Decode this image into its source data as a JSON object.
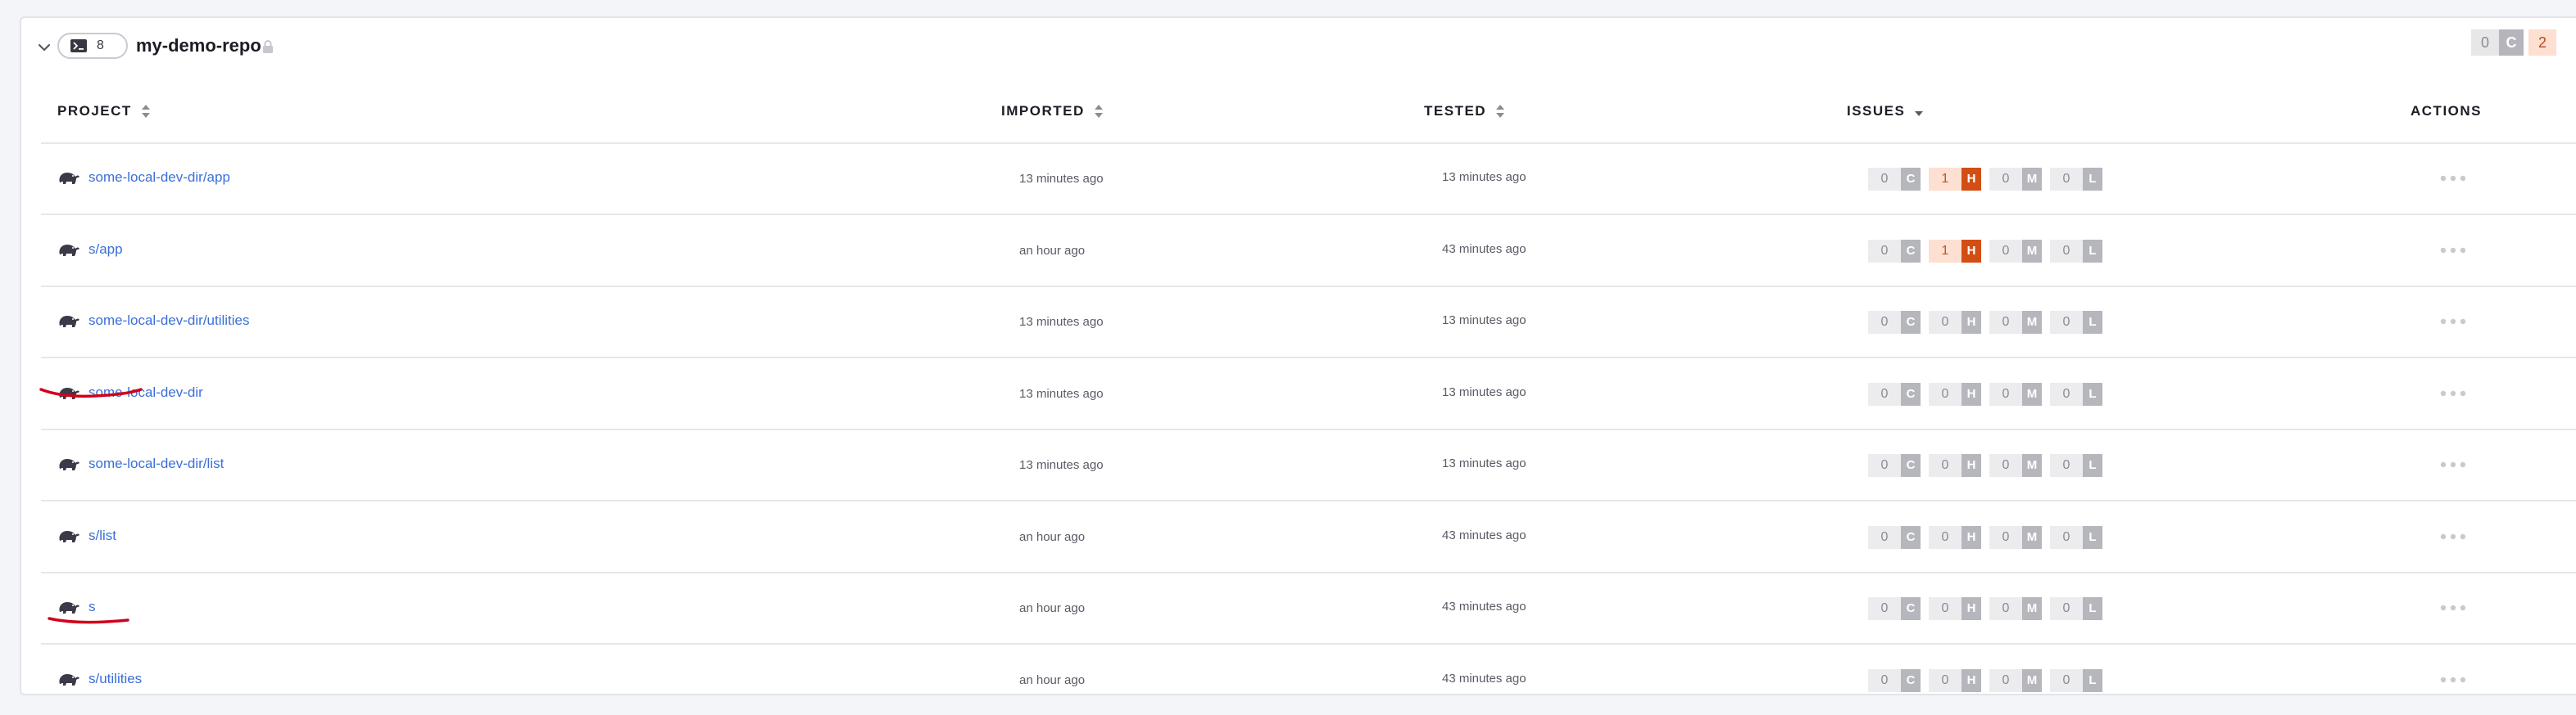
{
  "group": {
    "cli_count": "8",
    "repo_name": "my-demo-repo",
    "summary": {
      "critical_count": "0",
      "critical_label": "C",
      "high_count": "2"
    }
  },
  "columns": {
    "project": "PROJECT",
    "imported": "IMPORTED",
    "tested": "TESTED",
    "issues": "ISSUES",
    "actions": "ACTIONS"
  },
  "severity_labels": {
    "critical": "C",
    "high": "H",
    "medium": "M",
    "low": "L"
  },
  "colors": {
    "link": "#3a6fd8",
    "high_badge": "#d24e14",
    "annotation": "#d0021b"
  },
  "rows": [
    {
      "project": "some-local-dev-dir/app",
      "imported": "13 minutes ago",
      "tested": "13 minutes ago",
      "issues": {
        "critical": "0",
        "high": "1",
        "medium": "0",
        "low": "0"
      }
    },
    {
      "project": "s/app",
      "imported": "an hour ago",
      "tested": "43 minutes ago",
      "issues": {
        "critical": "0",
        "high": "1",
        "medium": "0",
        "low": "0"
      }
    },
    {
      "project": "some-local-dev-dir/utilities",
      "imported": "13 minutes ago",
      "tested": "13 minutes ago",
      "issues": {
        "critical": "0",
        "high": "0",
        "medium": "0",
        "low": "0"
      }
    },
    {
      "project": "some-local-dev-dir",
      "imported": "13 minutes ago",
      "tested": "13 minutes ago",
      "issues": {
        "critical": "0",
        "high": "0",
        "medium": "0",
        "low": "0"
      }
    },
    {
      "project": "some-local-dev-dir/list",
      "imported": "13 minutes ago",
      "tested": "13 minutes ago",
      "issues": {
        "critical": "0",
        "high": "0",
        "medium": "0",
        "low": "0"
      }
    },
    {
      "project": "s/list",
      "imported": "an hour ago",
      "tested": "43 minutes ago",
      "issues": {
        "critical": "0",
        "high": "0",
        "medium": "0",
        "low": "0"
      }
    },
    {
      "project": "s",
      "imported": "an hour ago",
      "tested": "43 minutes ago",
      "issues": {
        "critical": "0",
        "high": "0",
        "medium": "0",
        "low": "0"
      }
    },
    {
      "project": "s/utilities",
      "imported": "an hour ago",
      "tested": "43 minutes ago",
      "issues": {
        "critical": "0",
        "high": "0",
        "medium": "0",
        "low": "0"
      }
    }
  ]
}
